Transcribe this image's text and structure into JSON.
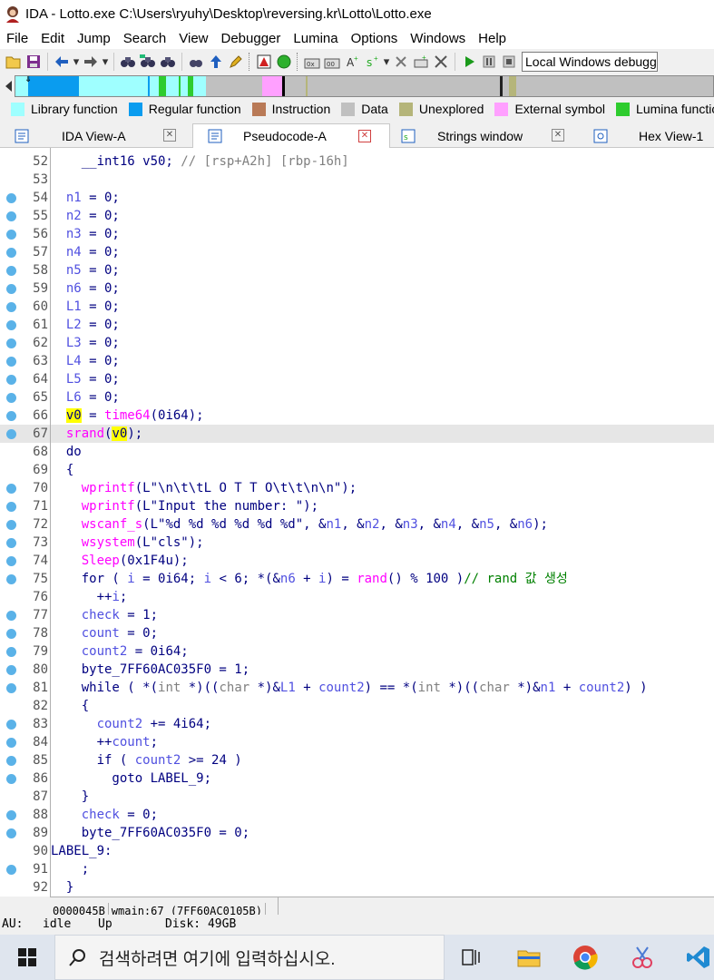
{
  "window": {
    "title": "IDA - Lotto.exe C:\\Users\\ryuhy\\Desktop\\reversing.kr\\Lotto\\Lotto.exe"
  },
  "menu": [
    "File",
    "Edit",
    "Jump",
    "Search",
    "View",
    "Debugger",
    "Lumina",
    "Options",
    "Windows",
    "Help"
  ],
  "toolbar": {
    "debugger_select": "Local Windows debugger"
  },
  "legend": [
    {
      "label": "Library function",
      "color": "#9fffff"
    },
    {
      "label": "Regular function",
      "color": "#0a9cef"
    },
    {
      "label": "Instruction",
      "color": "#b97a57"
    },
    {
      "label": "Data",
      "color": "#c0c0c0"
    },
    {
      "label": "Unexplored",
      "color": "#b5b57a"
    },
    {
      "label": "External symbol",
      "color": "#ffa0ff"
    },
    {
      "label": "Lumina function",
      "color": "#2ecc2e"
    }
  ],
  "tabs": [
    {
      "label": "IDA View-A",
      "active": false
    },
    {
      "label": "Pseudocode-A",
      "active": true
    },
    {
      "label": "Strings window",
      "active": false
    },
    {
      "label": "Hex View-1",
      "active": false
    }
  ],
  "code": {
    "lines": [
      {
        "n": "52",
        "bp": false,
        "t": [
          [
            "    __int16 v50; ",
            "n"
          ],
          [
            "// [rsp+A2h] [rbp-16h]",
            "g"
          ]
        ]
      },
      {
        "n": "53",
        "bp": false,
        "t": [
          [
            "",
            "n"
          ]
        ]
      },
      {
        "n": "54",
        "bp": true,
        "t": [
          [
            "  ",
            "n"
          ],
          [
            "n1",
            "v"
          ],
          [
            " = 0;",
            "n"
          ]
        ]
      },
      {
        "n": "55",
        "bp": true,
        "t": [
          [
            "  ",
            "n"
          ],
          [
            "n2",
            "v"
          ],
          [
            " = 0;",
            "n"
          ]
        ]
      },
      {
        "n": "56",
        "bp": true,
        "t": [
          [
            "  ",
            "n"
          ],
          [
            "n3",
            "v"
          ],
          [
            " = 0;",
            "n"
          ]
        ]
      },
      {
        "n": "57",
        "bp": true,
        "t": [
          [
            "  ",
            "n"
          ],
          [
            "n4",
            "v"
          ],
          [
            " = 0;",
            "n"
          ]
        ]
      },
      {
        "n": "58",
        "bp": true,
        "t": [
          [
            "  ",
            "n"
          ],
          [
            "n5",
            "v"
          ],
          [
            " = 0;",
            "n"
          ]
        ]
      },
      {
        "n": "59",
        "bp": true,
        "t": [
          [
            "  ",
            "n"
          ],
          [
            "n6",
            "v"
          ],
          [
            " = 0;",
            "n"
          ]
        ]
      },
      {
        "n": "60",
        "bp": true,
        "t": [
          [
            "  ",
            "n"
          ],
          [
            "L1",
            "v"
          ],
          [
            " = 0;",
            "n"
          ]
        ]
      },
      {
        "n": "61",
        "bp": true,
        "t": [
          [
            "  ",
            "n"
          ],
          [
            "L2",
            "v"
          ],
          [
            " = 0;",
            "n"
          ]
        ]
      },
      {
        "n": "62",
        "bp": true,
        "t": [
          [
            "  ",
            "n"
          ],
          [
            "L3",
            "v"
          ],
          [
            " = 0;",
            "n"
          ]
        ]
      },
      {
        "n": "63",
        "bp": true,
        "t": [
          [
            "  ",
            "n"
          ],
          [
            "L4",
            "v"
          ],
          [
            " = 0;",
            "n"
          ]
        ]
      },
      {
        "n": "64",
        "bp": true,
        "t": [
          [
            "  ",
            "n"
          ],
          [
            "L5",
            "v"
          ],
          [
            " = 0;",
            "n"
          ]
        ]
      },
      {
        "n": "65",
        "bp": true,
        "t": [
          [
            "  ",
            "n"
          ],
          [
            "L6",
            "v"
          ],
          [
            " = 0;",
            "n"
          ]
        ]
      },
      {
        "n": "66",
        "bp": true,
        "t": [
          [
            "  ",
            "n"
          ],
          [
            "v0",
            "y"
          ],
          [
            " = ",
            "n"
          ],
          [
            "time64",
            "f"
          ],
          [
            "(0i64);",
            "n"
          ]
        ]
      },
      {
        "n": "67",
        "bp": true,
        "hl": true,
        "t": [
          [
            "  ",
            "n"
          ],
          [
            "srand",
            "f"
          ],
          [
            "(",
            "n"
          ],
          [
            "v0",
            "y"
          ],
          [
            ");",
            "n"
          ]
        ]
      },
      {
        "n": "68",
        "bp": false,
        "t": [
          [
            "  do",
            "k"
          ]
        ]
      },
      {
        "n": "69",
        "bp": false,
        "t": [
          [
            "  {",
            "n"
          ]
        ]
      },
      {
        "n": "70",
        "bp": true,
        "t": [
          [
            "    ",
            "n"
          ],
          [
            "wprintf",
            "f"
          ],
          [
            "(L\"\\n\\t\\tL O T T O\\t\\t\\n\\n\");",
            "n"
          ]
        ]
      },
      {
        "n": "71",
        "bp": true,
        "t": [
          [
            "    ",
            "n"
          ],
          [
            "wprintf",
            "f"
          ],
          [
            "(L\"Input the number: \");",
            "n"
          ]
        ]
      },
      {
        "n": "72",
        "bp": true,
        "t": [
          [
            "    ",
            "n"
          ],
          [
            "wscanf_s",
            "f"
          ],
          [
            "(L\"%d %d %d %d %d %d\", &",
            "n"
          ],
          [
            "n1",
            "v"
          ],
          [
            ", &",
            "n"
          ],
          [
            "n2",
            "v"
          ],
          [
            ", &",
            "n"
          ],
          [
            "n3",
            "v"
          ],
          [
            ", &",
            "n"
          ],
          [
            "n4",
            "v"
          ],
          [
            ", &",
            "n"
          ],
          [
            "n5",
            "v"
          ],
          [
            ", &",
            "n"
          ],
          [
            "n6",
            "v"
          ],
          [
            ");",
            "n"
          ]
        ]
      },
      {
        "n": "73",
        "bp": true,
        "t": [
          [
            "    ",
            "n"
          ],
          [
            "wsystem",
            "f"
          ],
          [
            "(L\"cls\");",
            "n"
          ]
        ]
      },
      {
        "n": "74",
        "bp": true,
        "t": [
          [
            "    ",
            "n"
          ],
          [
            "Sleep",
            "f"
          ],
          [
            "(0x1F4u);",
            "n"
          ]
        ]
      },
      {
        "n": "75",
        "bp": true,
        "t": [
          [
            "    for ( ",
            "n"
          ],
          [
            "i",
            "v"
          ],
          [
            " = 0i64; ",
            "n"
          ],
          [
            "i",
            "v"
          ],
          [
            " < 6; *(&",
            "n"
          ],
          [
            "n6",
            "v"
          ],
          [
            " + ",
            "n"
          ],
          [
            "i",
            "v"
          ],
          [
            ") = ",
            "n"
          ],
          [
            "rand",
            "f"
          ],
          [
            "() % 100 )",
            "n"
          ],
          [
            "// rand 값 생성",
            "c"
          ]
        ]
      },
      {
        "n": "76",
        "bp": false,
        "t": [
          [
            "      ++",
            "n"
          ],
          [
            "i",
            "v"
          ],
          [
            ";",
            "n"
          ]
        ]
      },
      {
        "n": "77",
        "bp": true,
        "t": [
          [
            "    ",
            "n"
          ],
          [
            "check",
            "v"
          ],
          [
            " = 1;",
            "n"
          ]
        ]
      },
      {
        "n": "78",
        "bp": true,
        "t": [
          [
            "    ",
            "n"
          ],
          [
            "count",
            "v"
          ],
          [
            " = 0;",
            "n"
          ]
        ]
      },
      {
        "n": "79",
        "bp": true,
        "t": [
          [
            "    ",
            "n"
          ],
          [
            "count2",
            "v"
          ],
          [
            " = 0i64;",
            "n"
          ]
        ]
      },
      {
        "n": "80",
        "bp": true,
        "t": [
          [
            "    byte_7FF60AC035F0 = 1;",
            "n"
          ]
        ]
      },
      {
        "n": "81",
        "bp": true,
        "t": [
          [
            "    while ( *(",
            "n"
          ],
          [
            "int",
            "g"
          ],
          [
            " *)((",
            "n"
          ],
          [
            "char",
            "g"
          ],
          [
            " *)&",
            "n"
          ],
          [
            "L1",
            "v"
          ],
          [
            " + ",
            "n"
          ],
          [
            "count2",
            "v"
          ],
          [
            ") == *(",
            "n"
          ],
          [
            "int",
            "g"
          ],
          [
            " *)((",
            "n"
          ],
          [
            "char",
            "g"
          ],
          [
            " *)&",
            "n"
          ],
          [
            "n1",
            "v"
          ],
          [
            " + ",
            "n"
          ],
          [
            "count2",
            "v"
          ],
          [
            ") )",
            "n"
          ]
        ]
      },
      {
        "n": "82",
        "bp": false,
        "t": [
          [
            "    {",
            "n"
          ]
        ]
      },
      {
        "n": "83",
        "bp": true,
        "t": [
          [
            "      ",
            "n"
          ],
          [
            "count2",
            "v"
          ],
          [
            " += 4i64;",
            "n"
          ]
        ]
      },
      {
        "n": "84",
        "bp": true,
        "t": [
          [
            "      ++",
            "n"
          ],
          [
            "count",
            "v"
          ],
          [
            ";",
            "n"
          ]
        ]
      },
      {
        "n": "85",
        "bp": true,
        "t": [
          [
            "      if ( ",
            "n"
          ],
          [
            "count2",
            "v"
          ],
          [
            " >= 24 )",
            "n"
          ]
        ]
      },
      {
        "n": "86",
        "bp": true,
        "t": [
          [
            "        goto LABEL_9;",
            "n"
          ]
        ]
      },
      {
        "n": "87",
        "bp": false,
        "t": [
          [
            "    }",
            "n"
          ]
        ]
      },
      {
        "n": "88",
        "bp": true,
        "t": [
          [
            "    ",
            "n"
          ],
          [
            "check",
            "v"
          ],
          [
            " = 0;",
            "n"
          ]
        ]
      },
      {
        "n": "89",
        "bp": true,
        "t": [
          [
            "    byte_7FF60AC035F0 = 0;",
            "n"
          ]
        ]
      },
      {
        "n": "90",
        "bp": false,
        "t": [
          [
            "LABEL_9:",
            "n"
          ]
        ]
      },
      {
        "n": "91",
        "bp": true,
        "t": [
          [
            "    ;",
            "n"
          ]
        ]
      },
      {
        "n": "92",
        "bp": false,
        "t": [
          [
            "  }",
            "n"
          ]
        ]
      }
    ]
  },
  "status": {
    "address": "0000045B",
    "location": "wmain:67 (7FF60AC0105B)",
    "au_label": "AU:",
    "au_state": "idle",
    "direction": "Up",
    "disk": "Disk: 49GB"
  },
  "taskbar": {
    "search_placeholder": "검색하려면 여기에 입력하십시오."
  }
}
